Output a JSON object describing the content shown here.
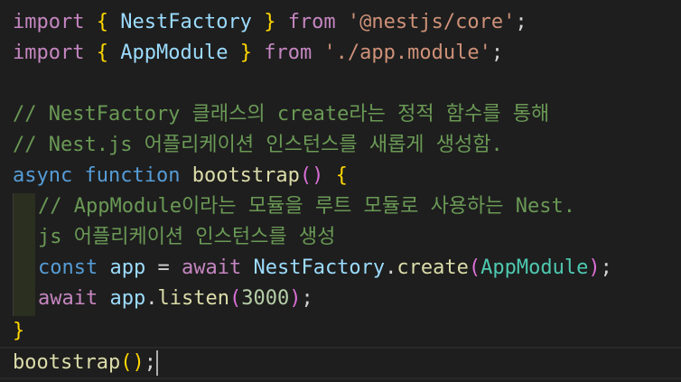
{
  "code": {
    "l1": {
      "kw": "import",
      "ob": "{",
      "cls": "NestFactory",
      "cb": "}",
      "from": "from",
      "str": "'@nestjs/core'",
      "semi": ";"
    },
    "l2": {
      "kw": "import",
      "ob": "{",
      "cls": "AppModule",
      "cb": "}",
      "from": "from",
      "str": "'./app.module'",
      "semi": ";"
    },
    "l4": "// NestFactory 클래스의 create라는 정적 함수를 통해",
    "l5": "// Nest.js 어플리케이션 인스턴스를 새롭게 생성함.",
    "l6": {
      "async": "async",
      "function": "function",
      "name": "bootstrap",
      "parens": "()",
      "brace": "{"
    },
    "l7": "// AppModule이라는 모듈을 루트 모듈로 사용하는 Nest.",
    "l7b": "js 어플리케이션 인스턴스를 생성",
    "l8": {
      "const": "const",
      "var": "app",
      "eq": "=",
      "await": "await",
      "cls": "NestFactory",
      "dot": ".",
      "method": "create",
      "op": "(",
      "arg": "AppModule",
      "cp": ")",
      "semi": ";"
    },
    "l9": {
      "await": "await",
      "var": "app",
      "dot": ".",
      "method": "listen",
      "op": "(",
      "num": "3000",
      "cp": ")",
      "semi": ";"
    },
    "l10": {
      "brace": "}"
    },
    "l11": {
      "name": "bootstrap",
      "parens": "()",
      "semi": ";"
    }
  },
  "colors": {
    "background": "#1e1e1e",
    "keyword_import": "#c586c0",
    "keyword": "#569cd6",
    "class": "#4ec9b0",
    "variable": "#9cdcfe",
    "string": "#ce9178",
    "function": "#dcdcaa",
    "number": "#b5cea8",
    "comment": "#6a9955",
    "bracket_level1": "#ffd700",
    "bracket_level2": "#da70d6"
  }
}
